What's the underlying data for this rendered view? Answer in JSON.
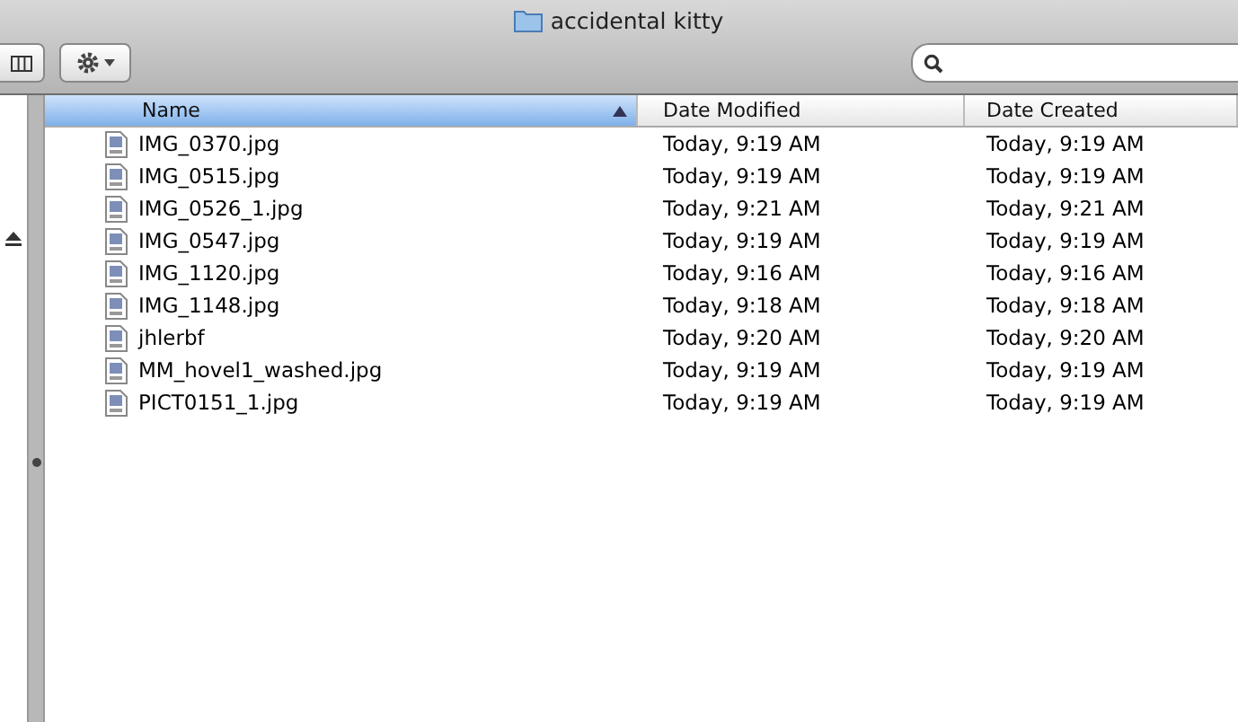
{
  "window": {
    "title": "accidental kitty"
  },
  "table": {
    "columns": [
      {
        "label": "Name",
        "selected": true
      },
      {
        "label": "Date Modified",
        "selected": false
      },
      {
        "label": "Date Created",
        "selected": false
      }
    ],
    "rows": [
      {
        "name": "IMG_0370.jpg",
        "modified": "Today, 9:19 AM",
        "created": "Today, 9:19 AM"
      },
      {
        "name": "IMG_0515.jpg",
        "modified": "Today, 9:19 AM",
        "created": "Today, 9:19 AM"
      },
      {
        "name": "IMG_0526_1.jpg",
        "modified": "Today, 9:21 AM",
        "created": "Today, 9:21 AM"
      },
      {
        "name": "IMG_0547.jpg",
        "modified": "Today, 9:19 AM",
        "created": "Today, 9:19 AM"
      },
      {
        "name": "IMG_1120.jpg",
        "modified": "Today, 9:16 AM",
        "created": "Today, 9:16 AM"
      },
      {
        "name": "IMG_1148.jpg",
        "modified": "Today, 9:18 AM",
        "created": "Today, 9:18 AM"
      },
      {
        "name": "jhlerbf",
        "modified": "Today, 9:20 AM",
        "created": "Today, 9:20 AM"
      },
      {
        "name": "MM_hovel1_washed.jpg",
        "modified": "Today, 9:19 AM",
        "created": "Today, 9:19 AM"
      },
      {
        "name": "PICT0151_1.jpg",
        "modified": "Today, 9:19 AM",
        "created": "Today, 9:19 AM"
      }
    ]
  }
}
